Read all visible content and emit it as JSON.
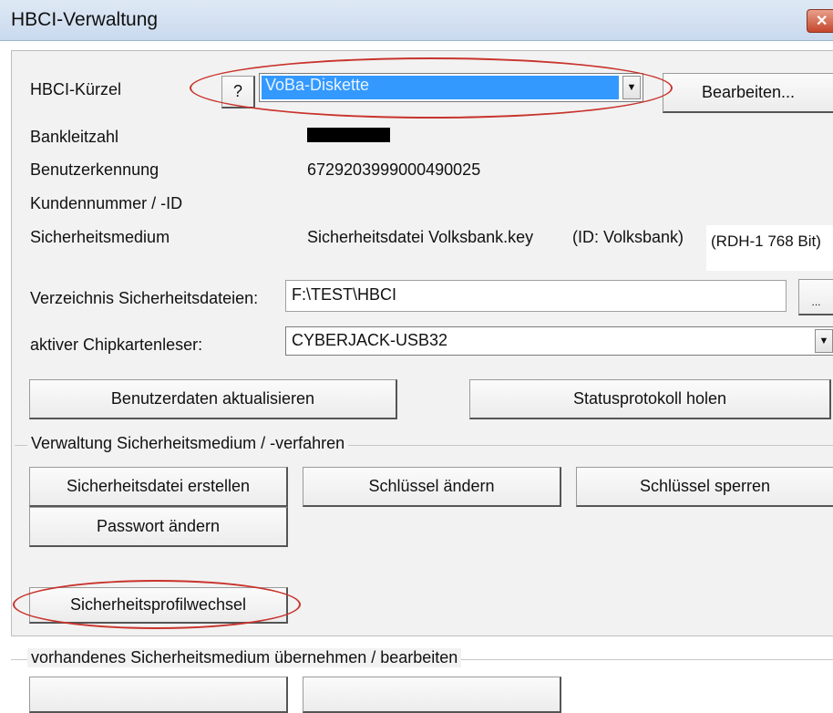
{
  "window": {
    "title": "HBCI-Verwaltung",
    "close_icon": "close-icon"
  },
  "kuerzel": {
    "label": "HBCI-Kürzel",
    "help_label": "?",
    "selected": "VoBa-Diskette",
    "edit_button": "Bearbeiten..."
  },
  "info": {
    "bankleitzahl_label": "Bankleitzahl",
    "benutzerkennung_label": "Benutzerkennung",
    "benutzerkennung_value": "6729203999000490025",
    "kundennummer_label": "Kundennummer / -ID",
    "sicherheitsmedium_label": "Sicherheitsmedium",
    "sicherheitsmedium_value": "Sicherheitsdatei Volksbank.key",
    "sicherheitsmedium_id": "(ID: Volksbank)",
    "sicherheitsmedium_rdh": "(RDH-1 768 Bit)"
  },
  "paths": {
    "verzeichnis_label": "Verzeichnis Sicherheitsdateien:",
    "verzeichnis_value": "F:\\TEST\\HBCI",
    "browse_label": "...",
    "chipkarten_label": "aktiver Chipkartenleser:",
    "chipkarten_value": "CYBERJACK-USB32"
  },
  "actions": {
    "benutzerdaten": "Benutzerdaten aktualisieren",
    "statusprotokoll": "Statusprotokoll holen"
  },
  "verwaltung": {
    "group_title": "Verwaltung Sicherheitsmedium / -verfahren",
    "erstellen": "Sicherheitsdatei erstellen",
    "schluessel_aendern": "Schlüssel ändern",
    "schluessel_sperren": "Schlüssel sperren",
    "passwort_aendern": "Passwort ändern",
    "profilwechsel": "Sicherheitsprofilwechsel"
  },
  "uebernehmen": {
    "group_title": "vorhandenes Sicherheitsmedium übernehmen / bearbeiten"
  },
  "colors": {
    "selection": "#3399ff",
    "annotation": "#c8342c"
  }
}
